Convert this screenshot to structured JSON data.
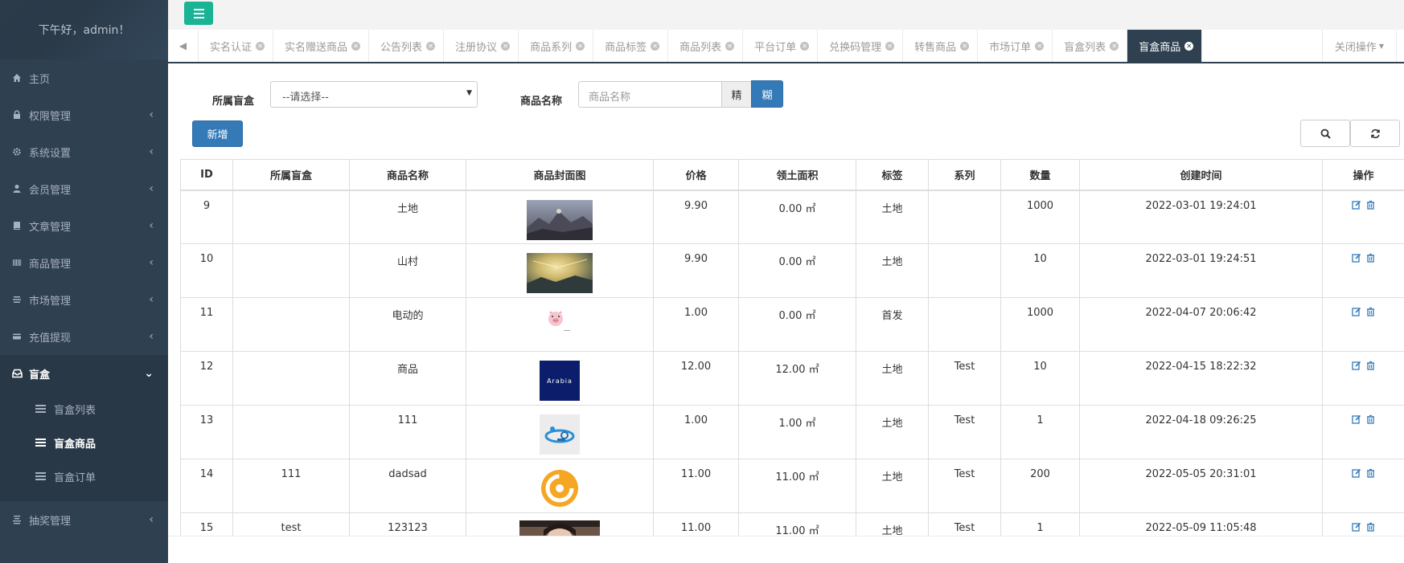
{
  "sidebar": {
    "greeting": "下午好，admin！",
    "items": [
      {
        "label": "主页",
        "icon": "home-icon"
      },
      {
        "label": "权限管理",
        "icon": "lock-icon"
      },
      {
        "label": "系统设置",
        "icon": "gear-icon"
      },
      {
        "label": "会员管理",
        "icon": "user-icon"
      },
      {
        "label": "文章管理",
        "icon": "book-icon"
      },
      {
        "label": "商品管理",
        "icon": "barcode-icon"
      },
      {
        "label": "市场管理",
        "icon": "list-icon"
      },
      {
        "label": "充值提现",
        "icon": "card-icon"
      },
      {
        "label": "盲盒",
        "icon": "inbox-icon"
      },
      {
        "label": "抽奖管理",
        "icon": "lottery-icon"
      }
    ],
    "sub_items": [
      {
        "label": "盲盒列表"
      },
      {
        "label": "盲盒商品"
      },
      {
        "label": "盲盒订单"
      }
    ]
  },
  "tabs": [
    {
      "label": "实名认证"
    },
    {
      "label": "实名赠送商品"
    },
    {
      "label": "公告列表"
    },
    {
      "label": "注册协议"
    },
    {
      "label": "商品系列"
    },
    {
      "label": "商品标签"
    },
    {
      "label": "商品列表"
    },
    {
      "label": "平台订单"
    },
    {
      "label": "兑换码管理"
    },
    {
      "label": "转售商品"
    },
    {
      "label": "市场订单"
    },
    {
      "label": "盲盒列表"
    },
    {
      "label": "盲盒商品"
    }
  ],
  "close_ops": "关闭操作",
  "form": {
    "box_label": "所属盲盒",
    "box_select": "--请选择--",
    "name_label": "商品名称",
    "name_placeholder": "商品名称",
    "exact_btn": "精",
    "fuzzy_btn": "糊"
  },
  "add_btn": "新增",
  "table": {
    "headers": [
      "ID",
      "所属盲盒",
      "商品名称",
      "商品封面图",
      "价格",
      "领土面积",
      "标签",
      "系列",
      "数量",
      "创建时间",
      "操作"
    ],
    "rows": [
      {
        "id": "9",
        "box": "",
        "name": "土地",
        "thumb": "landscape",
        "price": "9.90",
        "area": "0.00 ㎡",
        "tag": "土地",
        "series": "",
        "qty": "1000",
        "created": "2022-03-01 19:24:01"
      },
      {
        "id": "10",
        "box": "",
        "name": "山村",
        "thumb": "sunset",
        "price": "9.90",
        "area": "0.00 ㎡",
        "tag": "土地",
        "series": "",
        "qty": "10",
        "created": "2022-03-01 19:24:51"
      },
      {
        "id": "11",
        "box": "",
        "name": "电动的",
        "thumb": "pig",
        "price": "1.00",
        "area": "0.00 ㎡",
        "tag": "首发",
        "series": "",
        "qty": "1000",
        "created": "2022-04-07 20:06:42"
      },
      {
        "id": "12",
        "box": "",
        "name": "商品",
        "thumb": "arabia",
        "thumb_text": "Arabia",
        "price": "12.00",
        "area": "12.00 ㎡",
        "tag": "土地",
        "series": "Test",
        "qty": "10",
        "created": "2022-04-15 18:22:32"
      },
      {
        "id": "13",
        "box": "",
        "name": "111",
        "thumb": "logo-blue",
        "price": "1.00",
        "area": "1.00 ㎡",
        "tag": "土地",
        "series": "Test",
        "qty": "1",
        "created": "2022-04-18 09:26:25"
      },
      {
        "id": "14",
        "box": "111",
        "name": "dadsad",
        "thumb": "orange-logo",
        "price": "11.00",
        "area": "11.00 ㎡",
        "tag": "土地",
        "series": "Test",
        "qty": "200",
        "created": "2022-05-05 20:31:01"
      },
      {
        "id": "15",
        "box": "test",
        "name": "123123",
        "thumb": "photo",
        "price": "11.00",
        "area": "11.00 ㎡",
        "tag": "土地",
        "series": "Test",
        "qty": "1",
        "created": "2022-05-09 11:05:48"
      }
    ]
  },
  "colors": {
    "sidebar_bg": "#2f4050",
    "accent_green": "#1ab394",
    "primary_blue": "#337ab7"
  }
}
